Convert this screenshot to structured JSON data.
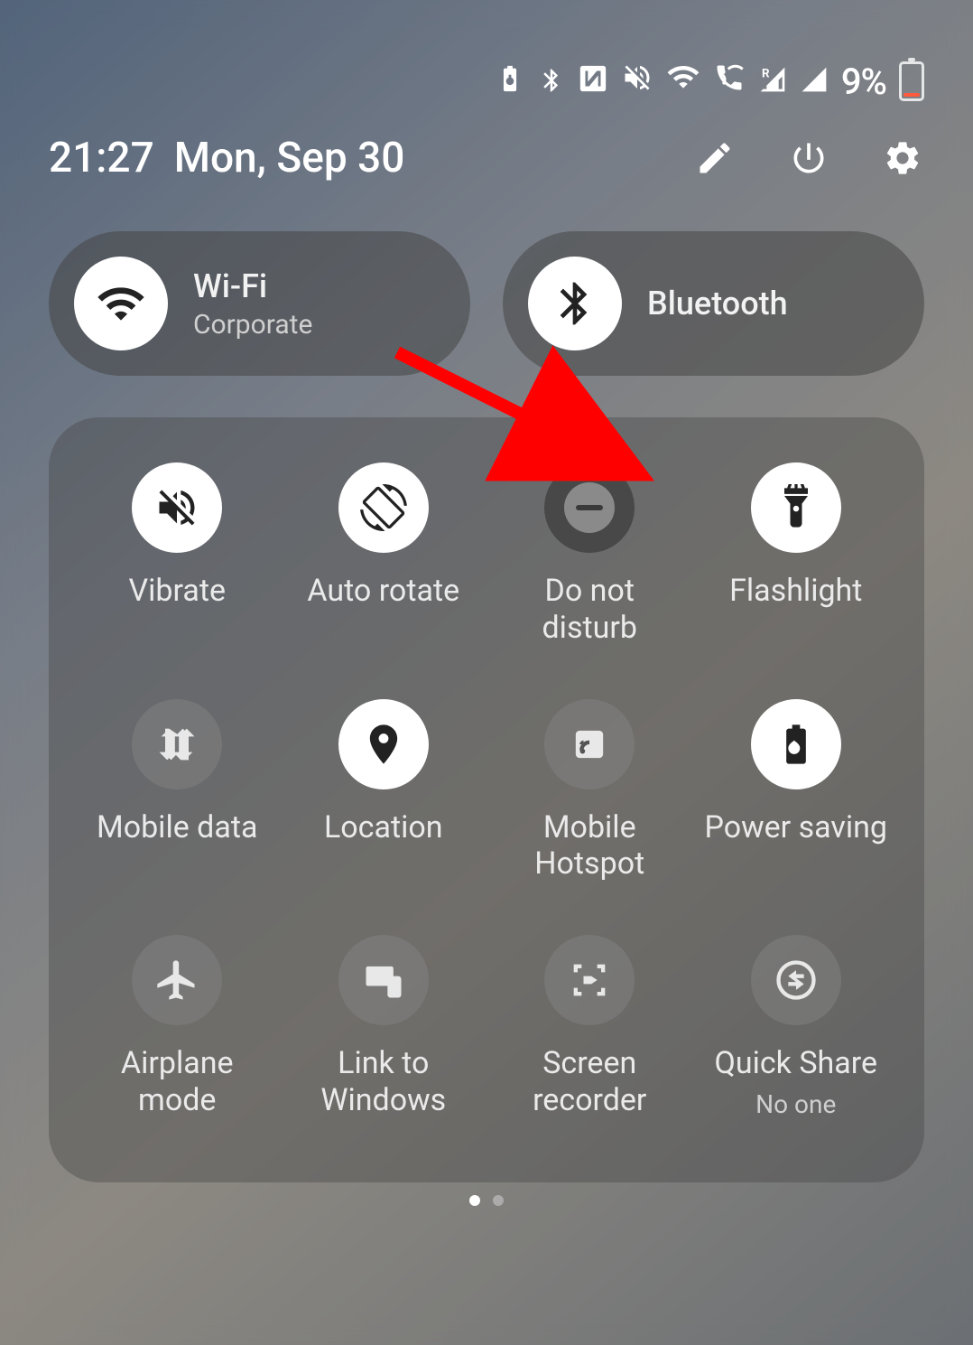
{
  "status": {
    "battery_percent": "9%"
  },
  "header": {
    "time": "21:27",
    "date": "Mon, Sep 30"
  },
  "big_tiles": {
    "wifi": {
      "title": "Wi-Fi",
      "subtitle": "Corporate"
    },
    "bluetooth": {
      "title": "Bluetooth"
    }
  },
  "tiles": [
    {
      "id": "vibrate",
      "label": "Vibrate",
      "state": "on"
    },
    {
      "id": "auto-rotate",
      "label": "Auto rotate",
      "state": "on"
    },
    {
      "id": "dnd",
      "label": "Do not disturb",
      "state": "dnd"
    },
    {
      "id": "flashlight",
      "label": "Flashlight",
      "state": "on"
    },
    {
      "id": "mobile-data",
      "label": "Mobile data",
      "state": "off"
    },
    {
      "id": "location",
      "label": "Location",
      "state": "on"
    },
    {
      "id": "mobile-hotspot",
      "label": "Mobile Hotspot",
      "state": "off"
    },
    {
      "id": "power-saving",
      "label": "Power saving",
      "state": "on"
    },
    {
      "id": "airplane",
      "label": "Airplane mode",
      "state": "off"
    },
    {
      "id": "link-windows",
      "label": "Link to Windows",
      "state": "off"
    },
    {
      "id": "screen-recorder",
      "label": "Screen recorder",
      "state": "off"
    },
    {
      "id": "quick-share",
      "label": "Quick Share",
      "sub": "No one",
      "state": "off"
    }
  ],
  "annotation": {
    "arrow_target": "flashlight"
  }
}
